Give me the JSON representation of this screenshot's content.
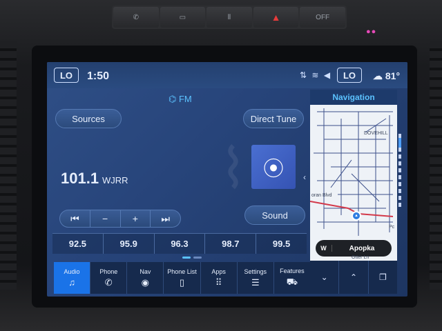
{
  "dash_buttons": [
    {
      "label": "",
      "icon": "phone-icon"
    },
    {
      "label": "",
      "icon": "camera-icon"
    },
    {
      "label": "",
      "icon": "parking-icon"
    },
    {
      "label": "▲",
      "icon": "hazard-icon"
    },
    {
      "label": "OFF",
      "icon": "traction-off-icon"
    }
  ],
  "status": {
    "left_climate": "LO",
    "time": "1:50",
    "right_climate": "LO",
    "temperature": "81°",
    "icons": [
      "signal-icon",
      "wifi-icon",
      "speaker-icon"
    ]
  },
  "radio": {
    "band": "FM",
    "sources_label": "Sources",
    "direct_tune_label": "Direct Tune",
    "sound_label": "Sound",
    "frequency": "101.1",
    "station": "WJRR",
    "controls": [
      {
        "symbol": "⏮",
        "name": "seek-back"
      },
      {
        "symbol": "−",
        "name": "tune-down"
      },
      {
        "symbol": "+",
        "name": "tune-up"
      },
      {
        "symbol": "⏭",
        "name": "seek-forward"
      }
    ],
    "presets": [
      "92.5",
      "95.9",
      "96.3",
      "98.7",
      "99.5"
    ]
  },
  "navbar": [
    {
      "label": "Audio",
      "icon": "♫",
      "active": true
    },
    {
      "label": "Phone",
      "icon": "✆",
      "active": false
    },
    {
      "label": "Nav",
      "icon": "◉",
      "active": false
    },
    {
      "label": "Phone List",
      "icon": "▯",
      "active": false
    },
    {
      "label": "Apps",
      "icon": "⠿",
      "active": false
    },
    {
      "label": "Settings",
      "icon": "☰",
      "active": false
    },
    {
      "label": "Features",
      "icon": "⛟",
      "active": false
    }
  ],
  "navigation": {
    "title": "Navigation",
    "map_labels": [
      "DOVEHILL",
      "oran Blvd",
      "Pc",
      "Otter Ln"
    ],
    "destination_dir": "W",
    "destination_name": "Apopka",
    "controls": [
      "⌄",
      "⌃",
      "❐"
    ]
  },
  "colors": {
    "accent": "#5bc2ff",
    "active_tab": "#1a73e8",
    "hazard": "#e43b3b"
  }
}
